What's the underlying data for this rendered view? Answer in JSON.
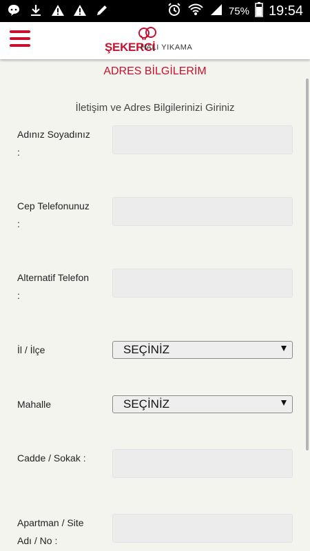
{
  "status_bar": {
    "battery": "75%",
    "time": "19:54",
    "icons": [
      "chat-bubble-icon",
      "download-icon",
      "warning-icon",
      "warning-icon",
      "edit-icon",
      "alarm-icon",
      "wifi-icon",
      "signal-icon",
      "battery-icon"
    ]
  },
  "header": {
    "brand": "ŞEKERCİ",
    "tagline": "HALI YIKAMA",
    "menu_icon": "hamburger-menu-icon",
    "brand_color": "#c8102e"
  },
  "page": {
    "title": "ADRES BİLGİLERİM",
    "subtitle": "İletişim ve Adres Bilgilerinizi Giriniz"
  },
  "form": {
    "name_label_line1": "Adınız Soyadınız",
    "name_label_line2": ":",
    "phone_label_line1": "Cep Telefonunuz",
    "phone_label_line2": ":",
    "alt_phone_label_line1": "Alternatif Telefon",
    "alt_phone_label_line2": ":",
    "city_label": "İl / İlçe",
    "city_value": "SEÇİNİZ",
    "district_label": "Mahalle",
    "district_value": "SEÇİNİZ",
    "street_label": "Cadde / Sokak :",
    "apartment_label_line1": "Apartman / Site",
    "apartment_label_line2": "Adı / No :"
  }
}
